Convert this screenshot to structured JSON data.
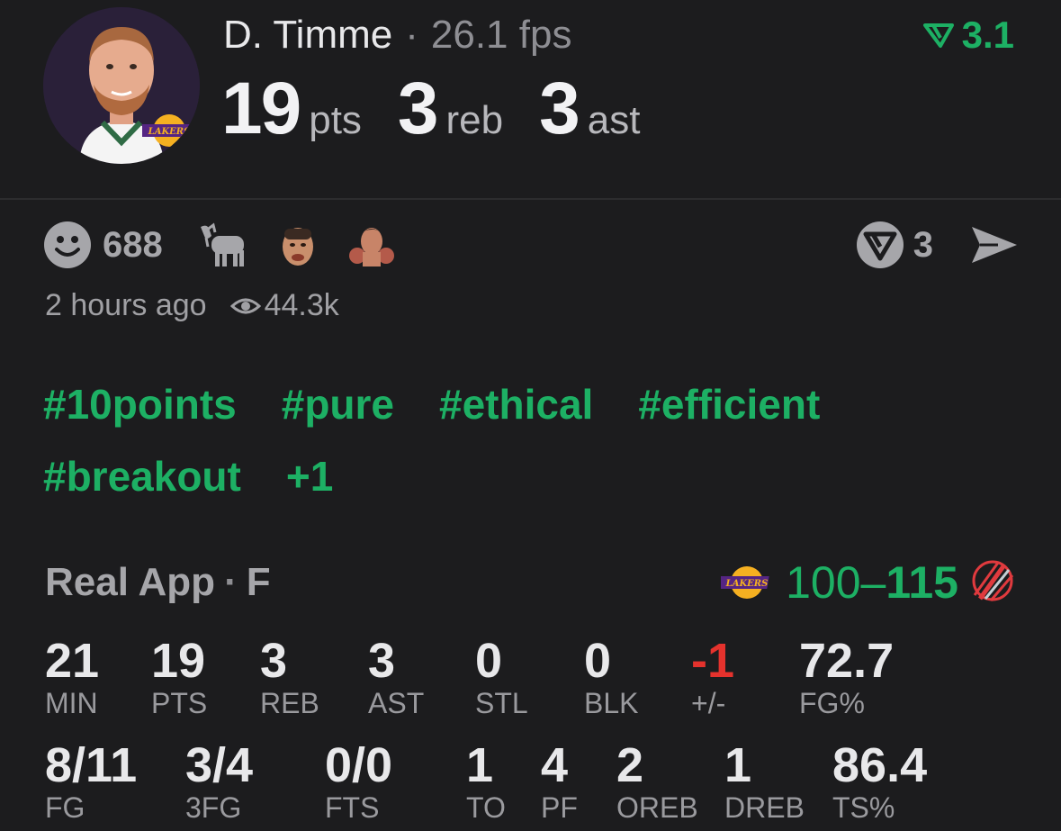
{
  "header": {
    "player_name": "D. Timme",
    "separator": "·",
    "fps": "26.1 fps",
    "score_value": "3.1",
    "stats": [
      {
        "value": "19",
        "unit": "pts"
      },
      {
        "value": "3",
        "unit": "reb"
      },
      {
        "value": "3",
        "unit": "ast"
      }
    ],
    "team_logo_text": "LAKERS"
  },
  "reactions": {
    "smile_count": "688",
    "share_count": "3"
  },
  "meta": {
    "time_ago": "2 hours ago",
    "views": "44.3k"
  },
  "tags": [
    "#10points",
    "#pure",
    "#ethical",
    "#efficient",
    "#breakout",
    "+1"
  ],
  "game": {
    "source": "Real App",
    "separator": "·",
    "status": "F",
    "home_logo_text": "LAKERS",
    "score_low": "100",
    "dash": "–",
    "score_high": "115"
  },
  "box_row1": [
    {
      "value": "21",
      "label": "MIN"
    },
    {
      "value": "19",
      "label": "PTS"
    },
    {
      "value": "3",
      "label": "REB"
    },
    {
      "value": "3",
      "label": "AST"
    },
    {
      "value": "0",
      "label": "STL"
    },
    {
      "value": "0",
      "label": "BLK"
    },
    {
      "value": "-1",
      "label": "+/-"
    },
    {
      "value": "72.7",
      "label": "FG%"
    }
  ],
  "box_row2": [
    {
      "value": "8/11",
      "label": "FG"
    },
    {
      "value": "3/4",
      "label": "3FG"
    },
    {
      "value": "0/0",
      "label": "FTS"
    },
    {
      "value": "1",
      "label": "TO"
    },
    {
      "value": "4",
      "label": "PF"
    },
    {
      "value": "2",
      "label": "OREB"
    },
    {
      "value": "1",
      "label": "DREB"
    },
    {
      "value": "86.4",
      "label": "TS%"
    }
  ],
  "colors": {
    "accent_green": "#1db064",
    "negative_red": "#e5322d",
    "background": "#1c1c1e"
  }
}
